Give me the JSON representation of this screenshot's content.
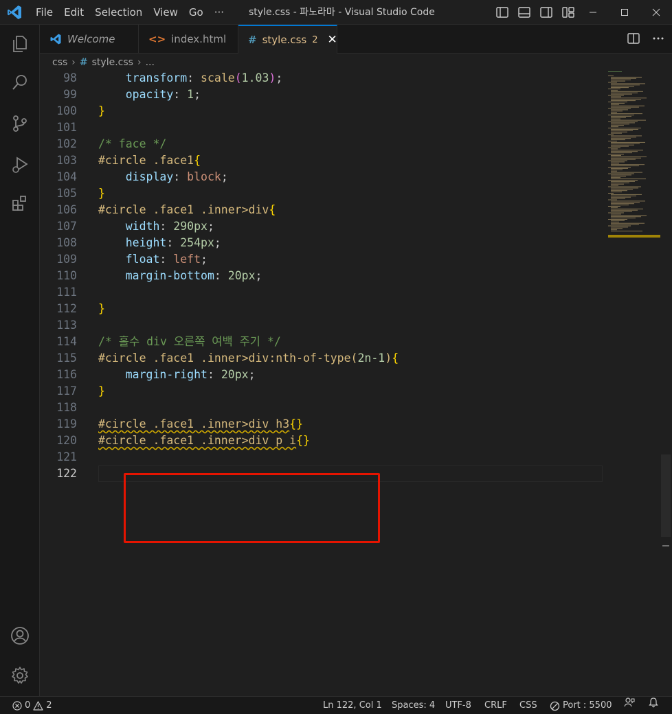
{
  "window": {
    "title": "style.css - 파노라마 - Visual Studio Code",
    "menu": [
      "File",
      "Edit",
      "Selection",
      "View",
      "Go",
      "···"
    ]
  },
  "tabs": [
    {
      "label": "Welcome",
      "icon": "vscode-logo-icon"
    },
    {
      "label": "index.html",
      "icon": "html-brackets-icon"
    },
    {
      "label": "style.css",
      "icon": "hash-icon",
      "badge": "2",
      "active": true
    }
  ],
  "breadcrumb": {
    "folder": "css",
    "file": "style.css",
    "more": "..."
  },
  "editor": {
    "current_line": "122",
    "lines": [
      {
        "n": "98",
        "tokens": [
          [
            "    ",
            ""
          ],
          [
            "transform",
            "prop"
          ],
          [
            ": ",
            "punct"
          ],
          [
            "scale",
            "kw2"
          ],
          [
            "(",
            "brace2"
          ],
          [
            "1.03",
            "num"
          ],
          [
            ")",
            "brace2"
          ],
          [
            ";",
            "punct"
          ]
        ]
      },
      {
        "n": "99",
        "tokens": [
          [
            "    ",
            ""
          ],
          [
            "opacity",
            "prop"
          ],
          [
            ": ",
            "punct"
          ],
          [
            "1",
            "num"
          ],
          [
            ";",
            "punct"
          ]
        ]
      },
      {
        "n": "100",
        "tokens": [
          [
            "}",
            "brace"
          ]
        ]
      },
      {
        "n": "101",
        "tokens": []
      },
      {
        "n": "102",
        "tokens": [
          [
            "/* face */",
            "cmt"
          ]
        ]
      },
      {
        "n": "103",
        "tokens": [
          [
            "#circle .face1",
            "sel"
          ],
          [
            "{",
            "brace"
          ]
        ]
      },
      {
        "n": "104",
        "tokens": [
          [
            "    ",
            ""
          ],
          [
            "display",
            "prop"
          ],
          [
            ": ",
            "punct"
          ],
          [
            "block",
            "kw"
          ],
          [
            ";",
            "punct"
          ]
        ]
      },
      {
        "n": "105",
        "tokens": [
          [
            "}",
            "brace"
          ]
        ]
      },
      {
        "n": "106",
        "tokens": [
          [
            "#circle .face1 .inner>div",
            "sel"
          ],
          [
            "{",
            "brace"
          ]
        ]
      },
      {
        "n": "107",
        "tokens": [
          [
            "    ",
            ""
          ],
          [
            "width",
            "prop"
          ],
          [
            ": ",
            "punct"
          ],
          [
            "290px",
            "num"
          ],
          [
            ";",
            "punct"
          ]
        ]
      },
      {
        "n": "108",
        "tokens": [
          [
            "    ",
            ""
          ],
          [
            "height",
            "prop"
          ],
          [
            ": ",
            "punct"
          ],
          [
            "254px",
            "num"
          ],
          [
            ";",
            "punct"
          ]
        ]
      },
      {
        "n": "109",
        "tokens": [
          [
            "    ",
            ""
          ],
          [
            "float",
            "prop"
          ],
          [
            ": ",
            "punct"
          ],
          [
            "left",
            "kw"
          ],
          [
            ";",
            "punct"
          ]
        ]
      },
      {
        "n": "110",
        "tokens": [
          [
            "    ",
            ""
          ],
          [
            "margin-bottom",
            "prop"
          ],
          [
            ": ",
            "punct"
          ],
          [
            "20px",
            "num"
          ],
          [
            ";",
            "punct"
          ]
        ]
      },
      {
        "n": "111",
        "tokens": []
      },
      {
        "n": "112",
        "tokens": [
          [
            "}",
            "brace"
          ]
        ]
      },
      {
        "n": "113",
        "tokens": []
      },
      {
        "n": "114",
        "tokens": [
          [
            "/* 홀수 div 오른쪽 여백 주기 */",
            "cmt"
          ]
        ]
      },
      {
        "n": "115",
        "tokens": [
          [
            "#circle .face1 .inner>div:nth-of-type(",
            "sel"
          ],
          [
            "2n-1",
            "num"
          ],
          [
            ")",
            "sel"
          ],
          [
            "{",
            "brace"
          ]
        ]
      },
      {
        "n": "116",
        "tokens": [
          [
            "    ",
            ""
          ],
          [
            "margin-right",
            "prop"
          ],
          [
            ": ",
            "punct"
          ],
          [
            "20px",
            "num"
          ],
          [
            ";",
            "punct"
          ]
        ]
      },
      {
        "n": "117",
        "tokens": [
          [
            "}",
            "brace"
          ]
        ]
      },
      {
        "n": "118",
        "tokens": []
      },
      {
        "n": "119",
        "tokens": [
          [
            "#circle .face1 .inner>div h3",
            "sel squig"
          ],
          [
            "{}",
            "brace"
          ]
        ]
      },
      {
        "n": "120",
        "tokens": [
          [
            "#circle .face1 .inner>div p i",
            "sel squig"
          ],
          [
            "{}",
            "brace"
          ]
        ]
      },
      {
        "n": "121",
        "tokens": []
      },
      {
        "n": "122",
        "tokens": []
      }
    ]
  },
  "statusbar": {
    "errors": "0",
    "warnings": "2",
    "position": "Ln 122, Col 1",
    "spaces": "Spaces: 4",
    "encoding": "UTF-8",
    "eol": "CRLF",
    "language": "CSS",
    "port": "Port : 5500"
  },
  "colors": {
    "accent": "#0078d4",
    "modified_tab": "#e2c08d",
    "highlight_box": "#e51400",
    "warning_squiggle": "#cca700"
  }
}
